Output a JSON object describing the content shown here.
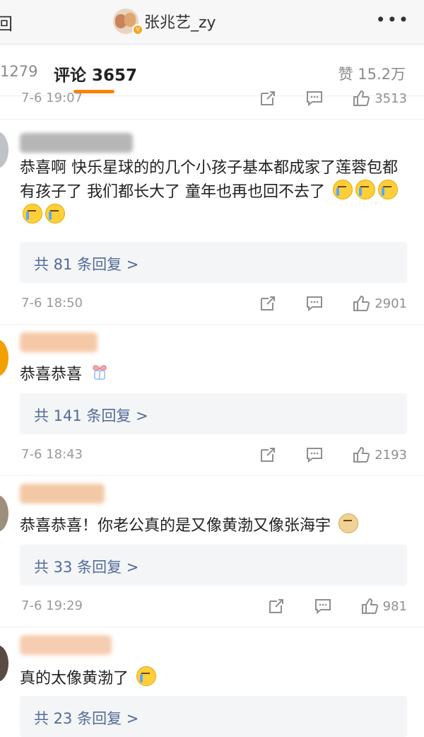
{
  "header": {
    "back_label": "回",
    "username": "张兆艺_zy",
    "more_label": "•••"
  },
  "tabs": {
    "reposts": "1279",
    "comments": "评论 3657",
    "likes": "赞 15.2万"
  },
  "top_comment_meta": {
    "time": "7-6 19:07",
    "likes": "3513"
  },
  "comments": [
    {
      "text": "恭喜啊  快乐星球的的几个小孩子基本都成家了莲蓉包都有孩子了  我们都长大了  童年也再也回不去了",
      "replies": "共 81 条回复 >",
      "time": "7-6 18:50",
      "likes": "2901"
    },
    {
      "text": "恭喜恭喜",
      "replies": "共 141 条回复 >",
      "time": "7-6 18:43",
      "likes": "2193"
    },
    {
      "text": "恭喜恭喜！你老公真的是又像黄渤又像张海宇",
      "replies": "共 33 条回复 >",
      "time": "7-6 19:29",
      "likes": "981"
    },
    {
      "text": "真的太像黄渤了",
      "replies": "共 23 条回复 >"
    }
  ],
  "icons": {
    "repost": "share-icon",
    "comment": "comment-icon",
    "like": "thumb-up-icon"
  },
  "colors": {
    "accent": "#ff8200",
    "reply_link": "#516b9a"
  }
}
